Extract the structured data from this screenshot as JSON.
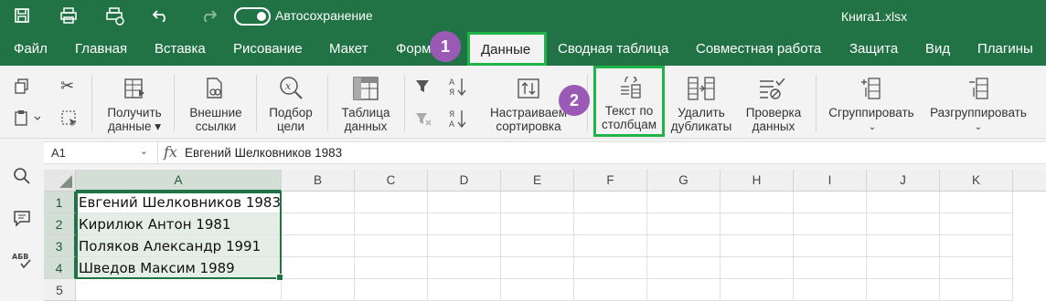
{
  "titlebar": {
    "autosave_label": "Автосохранение",
    "document_title": "Книга1.xlsx",
    "icons": [
      "save-icon",
      "print-icon",
      "quick-print-icon",
      "undo-icon",
      "redo-icon"
    ]
  },
  "menu": {
    "items": [
      "Файл",
      "Главная",
      "Вставка",
      "Рисование",
      "Макет",
      "Формулы",
      "Данные",
      "Сводная таблица",
      "Совместная работа",
      "Защита",
      "Вид",
      "Плагины"
    ],
    "visible_formulas": "Форм",
    "active": "Данные"
  },
  "badges": {
    "one": "1",
    "two": "2"
  },
  "ribbon": {
    "get_data": "Получить\nданные",
    "external_links": "Внешние\nссылки",
    "goal_seek": "Подбор\nцели",
    "data_table": "Таблица\nданных",
    "custom_sort": "Настраиваемая\nсортировка",
    "text_to_columns": "Текст по\nстолбцам",
    "remove_duplicates": "Удалить\nдубликаты",
    "data_validation": "Проверка\nданных",
    "group": "Сгруппировать",
    "ungroup": "Разгруппировать",
    "sort_az": "А↓Я",
    "sort_za": "Я↓А"
  },
  "formula_bar": {
    "cell_ref": "A1",
    "fx": "fx",
    "content": "Евгений Шелковников 1983"
  },
  "grid": {
    "columns": [
      "A",
      "B",
      "C",
      "D",
      "E",
      "F",
      "G",
      "H",
      "I",
      "J",
      "K"
    ],
    "rows": [
      "1",
      "2",
      "3",
      "4",
      "5"
    ],
    "cells_a": [
      "Евгений Шелковников 1983",
      "Кирилюк Антон 1981",
      "Поляков Александр 1991",
      "Шведов Максим 1989",
      ""
    ]
  },
  "colors": {
    "accent": "#217346",
    "highlight": "#1fb34a",
    "badge": "#9b59b6"
  }
}
